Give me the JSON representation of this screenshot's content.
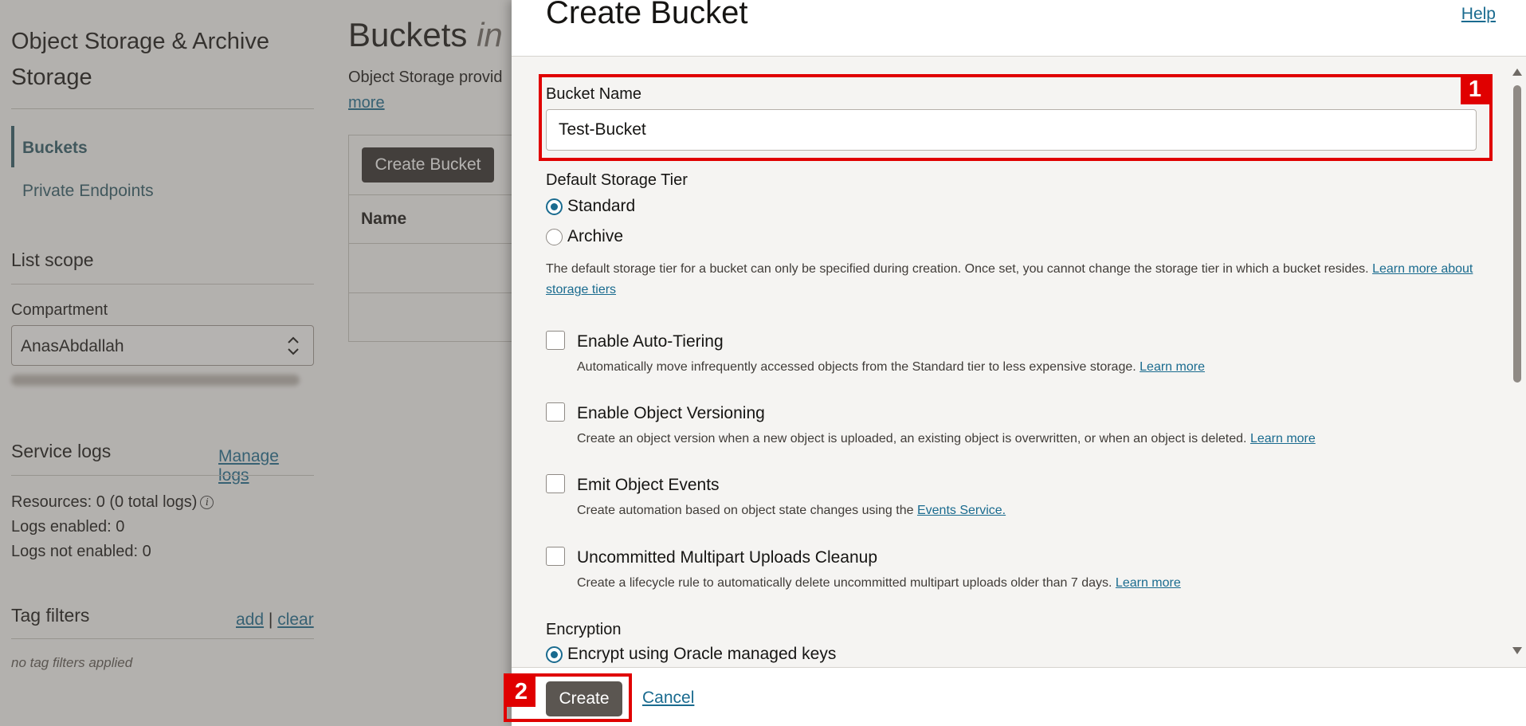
{
  "sidebar": {
    "title": "Object Storage & Archive Storage",
    "nav": {
      "buckets": "Buckets",
      "private_endpoints": "Private Endpoints"
    },
    "list_scope": {
      "heading": "List scope",
      "compartment_label": "Compartment",
      "compartment_value": "AnasAbdallah"
    },
    "service_logs": {
      "heading": "Service logs",
      "manage_link": "Manage logs",
      "resources": "Resources:  0 (0 total logs)",
      "logs_enabled": "Logs enabled:  0",
      "logs_not_enabled": "Logs not enabled:  0"
    },
    "tag_filters": {
      "heading": "Tag filters",
      "add": "add",
      "separator": "|",
      "clear": "clear",
      "note": "no tag filters applied"
    }
  },
  "main": {
    "title": "Buckets",
    "title_suffix": "in",
    "description": "Object Storage provid",
    "more_link": "more",
    "create_button": "Create Bucket",
    "table_header_name": "Name"
  },
  "panel": {
    "title": "Create Bucket",
    "help_link": "Help",
    "bucket_name": {
      "label": "Bucket Name",
      "value": "Test-Bucket"
    },
    "storage_tier": {
      "label": "Default Storage Tier",
      "options": [
        "Standard",
        "Archive"
      ],
      "selected": "Standard",
      "help": "The default storage tier for a bucket can only be specified during creation. Once set, you cannot change the storage tier in which a bucket resides.",
      "help_link": "Learn more about storage tiers"
    },
    "checkboxes": [
      {
        "label": "Enable Auto-Tiering",
        "description": "Automatically move infrequently accessed objects from the Standard tier to less expensive storage.",
        "link": "Learn more",
        "checked": false
      },
      {
        "label": "Enable Object Versioning",
        "description": "Create an object version when a new object is uploaded, an existing object is overwritten, or when an object is deleted.",
        "link": "Learn more",
        "checked": false
      },
      {
        "label": "Emit Object Events",
        "description": "Create automation based on object state changes using the",
        "link": "Events Service.",
        "checked": false
      },
      {
        "label": "Uncommitted Multipart Uploads Cleanup",
        "description": "Create a lifecycle rule to automatically delete uncommitted multipart uploads older than 7 days.",
        "link": "Learn more",
        "checked": false
      }
    ],
    "encryption": {
      "label": "Encryption",
      "option": "Encrypt using Oracle managed keys",
      "selected": true
    },
    "footer": {
      "create": "Create",
      "cancel": "Cancel"
    }
  },
  "annotations": {
    "step1": "1",
    "step2": "2"
  },
  "colors": {
    "accent": "#1a6b8f",
    "annotation": "#e00000",
    "primary_button": "#5b5651"
  }
}
